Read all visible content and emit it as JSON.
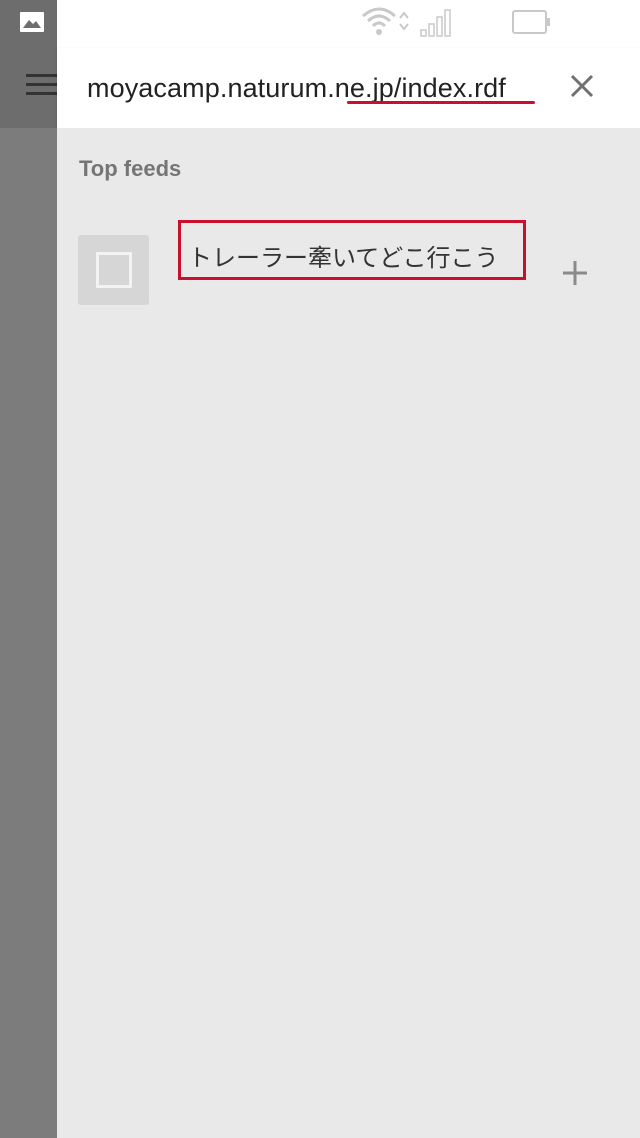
{
  "status_bar": {
    "icons": [
      "gallery-icon",
      "wifi-icon",
      "signal-icon",
      "battery-icon"
    ]
  },
  "header": {
    "url": "moyacamp.naturum.ne.jp/index.rdf",
    "menu_icon": "hamburger-icon",
    "close_icon": "close-icon"
  },
  "content": {
    "section_title": "Top feeds",
    "feeds": [
      {
        "title": "トレーラー牽いてどこ行こう",
        "thumbnail_icon": "feed-thumbnail-icon",
        "action_icon": "plus-icon"
      }
    ]
  },
  "colors": {
    "annotation_red": "#c8102e",
    "panel_background": "#e9e9e9",
    "scrim": "#7b7b7b"
  }
}
